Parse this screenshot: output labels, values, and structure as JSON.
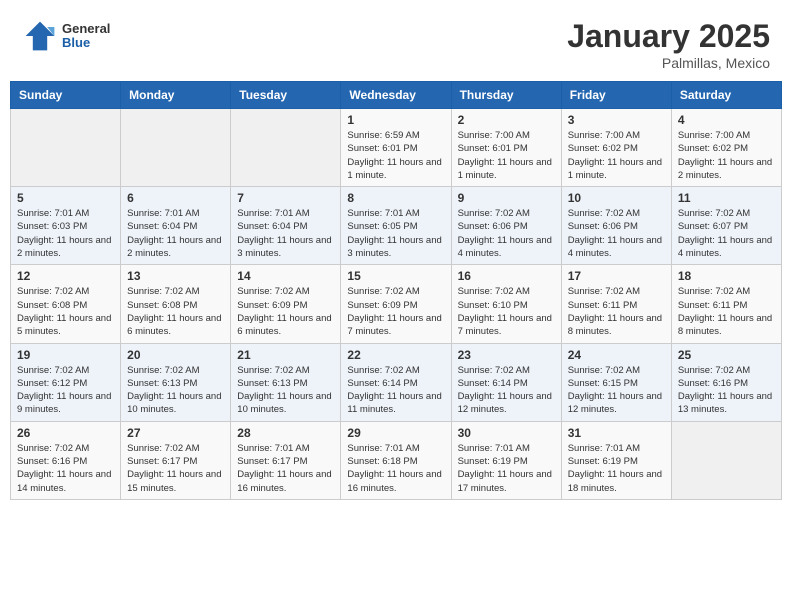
{
  "header": {
    "logo_general": "General",
    "logo_blue": "Blue",
    "month_year": "January 2025",
    "location": "Palmillas, Mexico"
  },
  "weekdays": [
    "Sunday",
    "Monday",
    "Tuesday",
    "Wednesday",
    "Thursday",
    "Friday",
    "Saturday"
  ],
  "weeks": [
    [
      {
        "day": "",
        "info": ""
      },
      {
        "day": "",
        "info": ""
      },
      {
        "day": "",
        "info": ""
      },
      {
        "day": "1",
        "info": "Sunrise: 6:59 AM\nSunset: 6:01 PM\nDaylight: 11 hours and 1 minute."
      },
      {
        "day": "2",
        "info": "Sunrise: 7:00 AM\nSunset: 6:01 PM\nDaylight: 11 hours and 1 minute."
      },
      {
        "day": "3",
        "info": "Sunrise: 7:00 AM\nSunset: 6:02 PM\nDaylight: 11 hours and 1 minute."
      },
      {
        "day": "4",
        "info": "Sunrise: 7:00 AM\nSunset: 6:02 PM\nDaylight: 11 hours and 2 minutes."
      }
    ],
    [
      {
        "day": "5",
        "info": "Sunrise: 7:01 AM\nSunset: 6:03 PM\nDaylight: 11 hours and 2 minutes."
      },
      {
        "day": "6",
        "info": "Sunrise: 7:01 AM\nSunset: 6:04 PM\nDaylight: 11 hours and 2 minutes."
      },
      {
        "day": "7",
        "info": "Sunrise: 7:01 AM\nSunset: 6:04 PM\nDaylight: 11 hours and 3 minutes."
      },
      {
        "day": "8",
        "info": "Sunrise: 7:01 AM\nSunset: 6:05 PM\nDaylight: 11 hours and 3 minutes."
      },
      {
        "day": "9",
        "info": "Sunrise: 7:02 AM\nSunset: 6:06 PM\nDaylight: 11 hours and 4 minutes."
      },
      {
        "day": "10",
        "info": "Sunrise: 7:02 AM\nSunset: 6:06 PM\nDaylight: 11 hours and 4 minutes."
      },
      {
        "day": "11",
        "info": "Sunrise: 7:02 AM\nSunset: 6:07 PM\nDaylight: 11 hours and 4 minutes."
      }
    ],
    [
      {
        "day": "12",
        "info": "Sunrise: 7:02 AM\nSunset: 6:08 PM\nDaylight: 11 hours and 5 minutes."
      },
      {
        "day": "13",
        "info": "Sunrise: 7:02 AM\nSunset: 6:08 PM\nDaylight: 11 hours and 6 minutes."
      },
      {
        "day": "14",
        "info": "Sunrise: 7:02 AM\nSunset: 6:09 PM\nDaylight: 11 hours and 6 minutes."
      },
      {
        "day": "15",
        "info": "Sunrise: 7:02 AM\nSunset: 6:09 PM\nDaylight: 11 hours and 7 minutes."
      },
      {
        "day": "16",
        "info": "Sunrise: 7:02 AM\nSunset: 6:10 PM\nDaylight: 11 hours and 7 minutes."
      },
      {
        "day": "17",
        "info": "Sunrise: 7:02 AM\nSunset: 6:11 PM\nDaylight: 11 hours and 8 minutes."
      },
      {
        "day": "18",
        "info": "Sunrise: 7:02 AM\nSunset: 6:11 PM\nDaylight: 11 hours and 8 minutes."
      }
    ],
    [
      {
        "day": "19",
        "info": "Sunrise: 7:02 AM\nSunset: 6:12 PM\nDaylight: 11 hours and 9 minutes."
      },
      {
        "day": "20",
        "info": "Sunrise: 7:02 AM\nSunset: 6:13 PM\nDaylight: 11 hours and 10 minutes."
      },
      {
        "day": "21",
        "info": "Sunrise: 7:02 AM\nSunset: 6:13 PM\nDaylight: 11 hours and 10 minutes."
      },
      {
        "day": "22",
        "info": "Sunrise: 7:02 AM\nSunset: 6:14 PM\nDaylight: 11 hours and 11 minutes."
      },
      {
        "day": "23",
        "info": "Sunrise: 7:02 AM\nSunset: 6:14 PM\nDaylight: 11 hours and 12 minutes."
      },
      {
        "day": "24",
        "info": "Sunrise: 7:02 AM\nSunset: 6:15 PM\nDaylight: 11 hours and 12 minutes."
      },
      {
        "day": "25",
        "info": "Sunrise: 7:02 AM\nSunset: 6:16 PM\nDaylight: 11 hours and 13 minutes."
      }
    ],
    [
      {
        "day": "26",
        "info": "Sunrise: 7:02 AM\nSunset: 6:16 PM\nDaylight: 11 hours and 14 minutes."
      },
      {
        "day": "27",
        "info": "Sunrise: 7:02 AM\nSunset: 6:17 PM\nDaylight: 11 hours and 15 minutes."
      },
      {
        "day": "28",
        "info": "Sunrise: 7:01 AM\nSunset: 6:17 PM\nDaylight: 11 hours and 16 minutes."
      },
      {
        "day": "29",
        "info": "Sunrise: 7:01 AM\nSunset: 6:18 PM\nDaylight: 11 hours and 16 minutes."
      },
      {
        "day": "30",
        "info": "Sunrise: 7:01 AM\nSunset: 6:19 PM\nDaylight: 11 hours and 17 minutes."
      },
      {
        "day": "31",
        "info": "Sunrise: 7:01 AM\nSunset: 6:19 PM\nDaylight: 11 hours and 18 minutes."
      },
      {
        "day": "",
        "info": ""
      }
    ]
  ]
}
